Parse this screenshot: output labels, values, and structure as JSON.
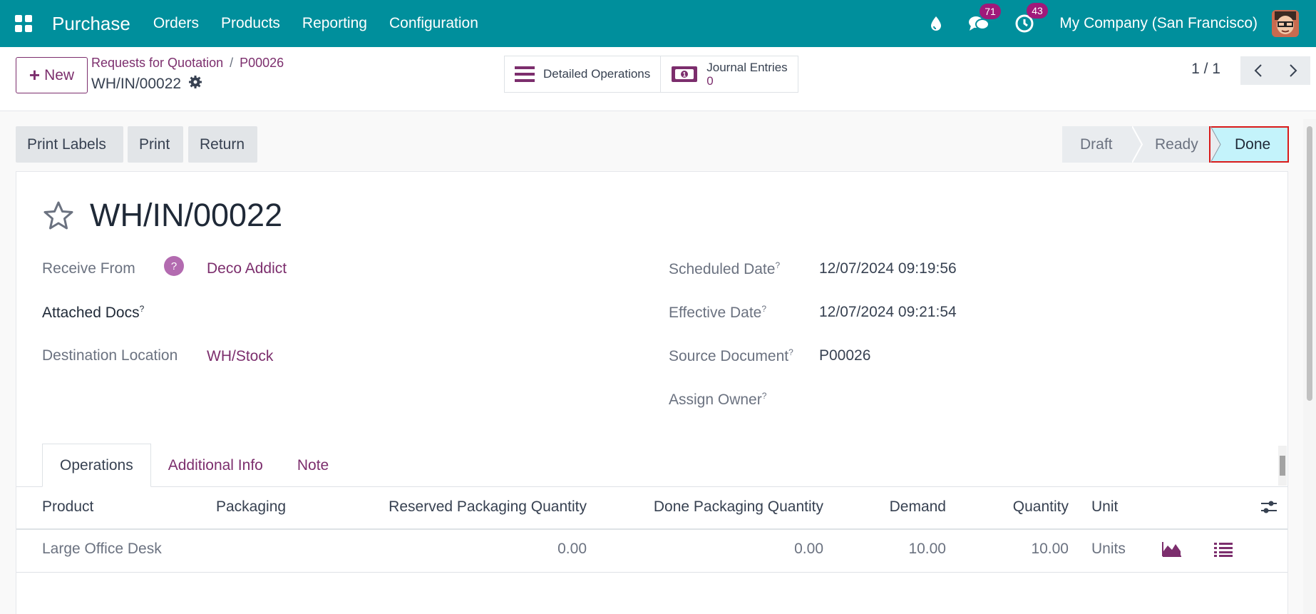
{
  "topnav": {
    "app_name": "Purchase",
    "menu": [
      "Orders",
      "Products",
      "Reporting",
      "Configuration"
    ],
    "messages_count": "71",
    "activities_count": "43",
    "company": "My Company (San Francisco)",
    "icons": [
      "apps-grid-icon",
      "droplet-icon",
      "chat-icon",
      "clock-icon",
      "user-avatar"
    ]
  },
  "control_panel": {
    "new_label": "New",
    "breadcrumb": [
      "Requests for Quotation",
      "P00026"
    ],
    "record_name": "WH/IN/00022",
    "detailed_operations": "Detailed Operations",
    "journal_entries_label": "Journal Entries",
    "journal_entries_count": "0",
    "pager": "1 / 1"
  },
  "actions": {
    "print_labels": "Print Labels",
    "print": "Print",
    "return": "Return"
  },
  "status": {
    "stages": [
      "Draft",
      "Ready",
      "Done"
    ],
    "current": "Done"
  },
  "form": {
    "title": "WH/IN/00022",
    "receive_from_label": "Receive From",
    "receive_from_value": "Deco Addict",
    "help_symbol": "?",
    "attached_docs_label": "Attached Docs",
    "destination_label": "Destination Location",
    "destination_value": "WH/Stock",
    "scheduled_label": "Scheduled Date",
    "scheduled_value": "12/07/2024 09:19:56",
    "effective_label": "Effective Date",
    "effective_value": "12/07/2024 09:21:54",
    "source_label": "Source Document",
    "source_value": "P00026",
    "owner_label": "Assign Owner",
    "tooltip_mark": "?"
  },
  "tabs": [
    "Operations",
    "Additional Info",
    "Note"
  ],
  "table": {
    "headers": [
      "Product",
      "Packaging",
      "Reserved Packaging Quantity",
      "Done Packaging Quantity",
      "Demand",
      "Quantity",
      "Unit"
    ],
    "rows": [
      {
        "product": "Large Office Desk",
        "packaging": "",
        "reserved": "0.00",
        "done": "0.00",
        "demand": "10.00",
        "quantity": "10.00",
        "unit": "Units"
      }
    ]
  },
  "colors": {
    "navbar": "#008f9c",
    "link": "#7c2e6d",
    "active_stage": "#c4f3fb",
    "highlight": "#d91a1a"
  }
}
